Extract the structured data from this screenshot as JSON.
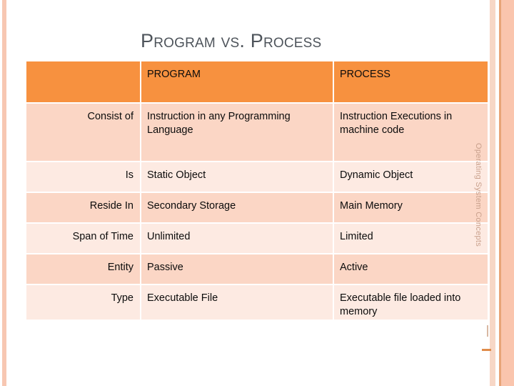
{
  "slide": {
    "title": "Program vs. Process",
    "side_note": "Operating System Concepts"
  },
  "table": {
    "headers": {
      "label": "",
      "program": "PROGRAM",
      "process": "PROCESS"
    },
    "rows": [
      {
        "label": "Consist of",
        "program": "Instruction in any Programming Language",
        "process": "Instruction Executions in machine code"
      },
      {
        "label": "Is",
        "program": "Static Object",
        "process": "Dynamic Object"
      },
      {
        "label": "Reside In",
        "program": "Secondary Storage",
        "process": "Main Memory"
      },
      {
        "label": "Span of Time",
        "program": "Unlimited",
        "process": "Limited"
      },
      {
        "label": "Entity",
        "program": "Passive",
        "process": "Active"
      },
      {
        "label": "Type",
        "program": "Executable File",
        "process": "Executable file loaded into memory"
      }
    ]
  },
  "colors": {
    "header_orange": "#f7913f",
    "row_dark": "#fbd6c5",
    "row_light": "#fdeae2",
    "title_gray": "#4e545b",
    "edge_peach": "#fac5ad"
  }
}
